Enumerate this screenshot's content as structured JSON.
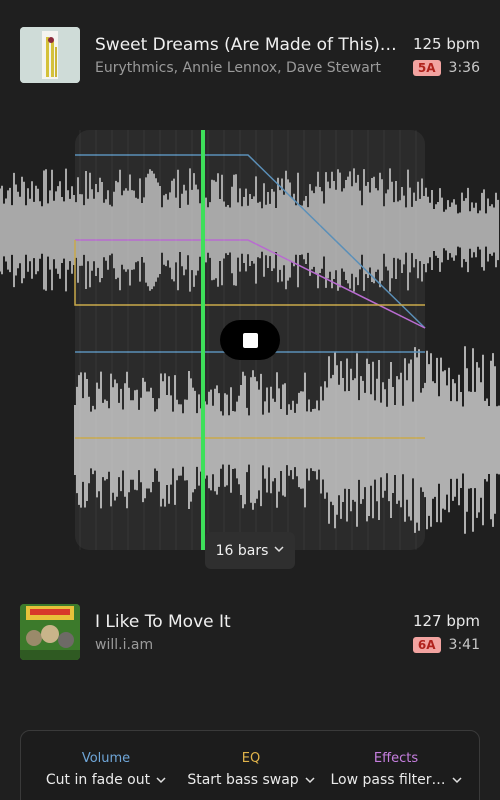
{
  "tracks": [
    {
      "title": "Sweet Dreams (Are Made of This) - 2…",
      "artist": "Eurythmics, Annie Lennox, Dave Stewart",
      "bpm": "125 bpm",
      "key": "5A",
      "duration": "3:36"
    },
    {
      "title": "I Like To Move It",
      "artist": "will.i.am",
      "bpm": "127 bpm",
      "key": "6A",
      "duration": "3:41"
    }
  ],
  "editor": {
    "bars_label": "16 bars",
    "playhead_color": "#3ee05a",
    "volume_color": "#5a8fb8",
    "eq_color": "#c9a94a",
    "effects_color": "#b86bd0"
  },
  "controls": {
    "volume": {
      "label": "Volume",
      "value": "Cut in fade out",
      "color": "#6fa6d8"
    },
    "eq": {
      "label": "EQ",
      "value": "Start bass swap",
      "color": "#e0b34a"
    },
    "effects": {
      "label": "Effects",
      "value": "Low pass filter…",
      "color": "#c77fe0"
    }
  },
  "icons": {
    "stop": "stop-icon",
    "chevron": "chevron-down-icon"
  }
}
